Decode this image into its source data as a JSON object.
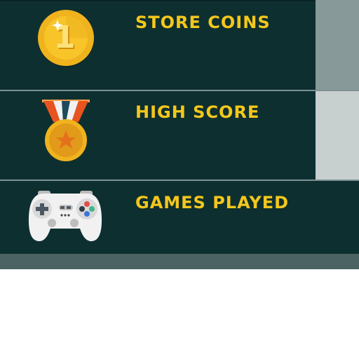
{
  "stats": {
    "rows": [
      {
        "label": "STORE COINS",
        "icon": "coin-icon",
        "badge_number": "1"
      },
      {
        "label": "HIGH SCORE",
        "icon": "medal-icon"
      },
      {
        "label": "GAMES PLAYED",
        "icon": "gamepad-icon"
      }
    ]
  },
  "colors": {
    "panel_background": "#0e2f2f",
    "label_text": "#f3c71b",
    "divider": "#7d9393",
    "bottom_bar": "#4b6463",
    "side_tab_1": "#879a99",
    "side_tab_2": "#c8cfcf"
  }
}
